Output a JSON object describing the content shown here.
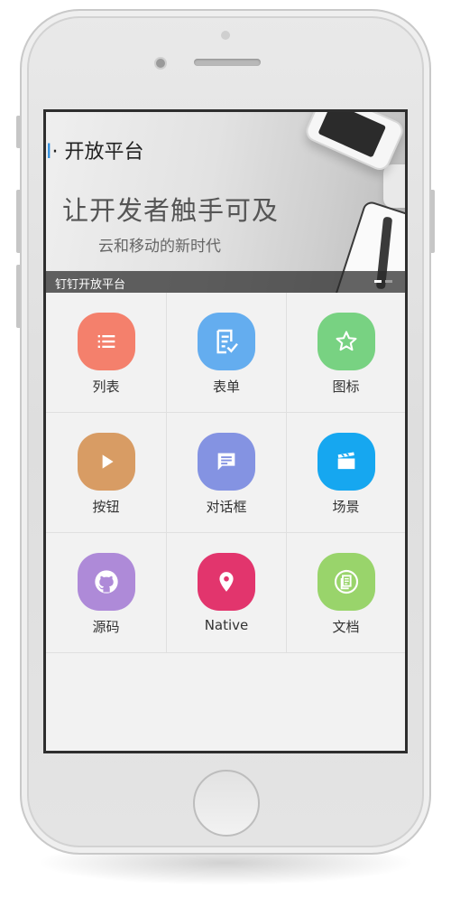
{
  "banner": {
    "brand_mark": "I",
    "brand_text": "· 开放平台",
    "headline": "让开发者触手可及",
    "subline": "云和移动的新时代",
    "caption": "钉钉开放平台",
    "slides_total": 2,
    "slides_active": 1
  },
  "grid": {
    "items": [
      {
        "label": "列表",
        "icon": "list-icon",
        "color": "#F4806C"
      },
      {
        "label": "表单",
        "icon": "form-icon",
        "color": "#64ADEF"
      },
      {
        "label": "图标",
        "icon": "star-icon",
        "color": "#78D282"
      },
      {
        "label": "按钮",
        "icon": "play-icon",
        "color": "#D89C64"
      },
      {
        "label": "对话框",
        "icon": "chat-icon",
        "color": "#8493E2"
      },
      {
        "label": "场景",
        "icon": "clapboard-icon",
        "color": "#16A7F0"
      },
      {
        "label": "源码",
        "icon": "github-icon",
        "color": "#AE8AD8"
      },
      {
        "label": "Native",
        "icon": "location-pin-icon",
        "color": "#E2356D"
      },
      {
        "label": "文档",
        "icon": "document-icon",
        "color": "#99D46B"
      }
    ]
  }
}
